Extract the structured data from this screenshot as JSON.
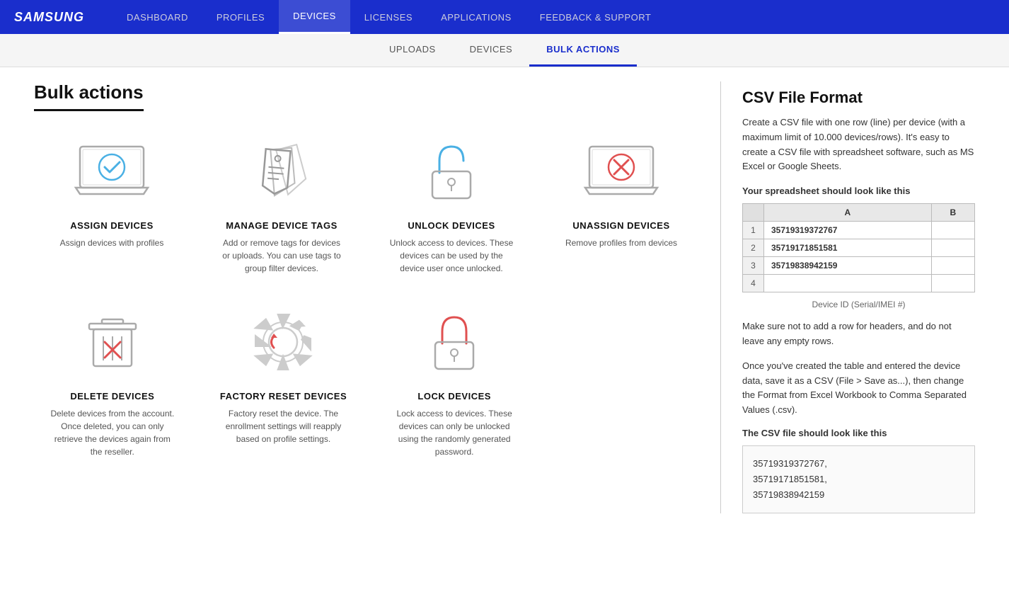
{
  "logo": "SAMSUNG",
  "nav": {
    "links": [
      {
        "label": "DASHBOARD",
        "active": false
      },
      {
        "label": "PROFILES",
        "active": false
      },
      {
        "label": "DEVICES",
        "active": true
      },
      {
        "label": "LICENSES",
        "active": false
      },
      {
        "label": "APPLICATIONS",
        "active": false
      },
      {
        "label": "FEEDBACK & SUPPORT",
        "active": false
      }
    ]
  },
  "subnav": {
    "tabs": [
      {
        "label": "UPLOADS",
        "active": false
      },
      {
        "label": "DEVICES",
        "active": false
      },
      {
        "label": "BULK ACTIONS",
        "active": true
      }
    ]
  },
  "page": {
    "title": "Bulk actions"
  },
  "actions_row1": [
    {
      "id": "assign",
      "title": "ASSIGN DEVICES",
      "desc": "Assign devices with profiles",
      "icon_type": "assign"
    },
    {
      "id": "manage-tags",
      "title": "MANAGE DEVICE TAGS",
      "desc": "Add or remove tags for devices or uploads. You can use tags to group filter devices.",
      "icon_type": "tags"
    },
    {
      "id": "unlock",
      "title": "UNLOCK DEVICES",
      "desc": "Unlock access to devices. These devices can be used by the device user once unlocked.",
      "icon_type": "unlock"
    },
    {
      "id": "unassign",
      "title": "UNASSIGN DEVICES",
      "desc": "Remove profiles from devices",
      "icon_type": "unassign"
    }
  ],
  "actions_row2": [
    {
      "id": "delete",
      "title": "DELETE DEVICES",
      "desc": "Delete devices from the account. Once deleted, you can only retrieve the devices again from the reseller.",
      "icon_type": "delete"
    },
    {
      "id": "factory-reset",
      "title": "FACTORY RESET DEVICES",
      "desc": "Factory reset the device. The enrollment settings will reapply based on profile settings.",
      "icon_type": "factory-reset"
    },
    {
      "id": "lock",
      "title": "LOCK DEVICES",
      "desc": "Lock access to devices. These devices can only be unlocked using the randomly generated password.",
      "icon_type": "lock"
    }
  ],
  "csv_panel": {
    "title": "CSV File Format",
    "desc": "Create a CSV file with one row (line) per device (with a maximum limit of 10.000 devices/rows). It's easy to create a CSV file with spreadsheet software, such as MS Excel or Google Sheets.",
    "spreadsheet_label": "Your spreadsheet should look like this",
    "columns": [
      "",
      "A",
      "B"
    ],
    "rows": [
      {
        "row": "1",
        "a": "35719319372767",
        "b": ""
      },
      {
        "row": "2",
        "a": "35719171851581",
        "b": ""
      },
      {
        "row": "3",
        "a": "35719838942159",
        "b": ""
      },
      {
        "row": "4",
        "a": "",
        "b": ""
      }
    ],
    "device_id_label": "Device ID (Serial/IMEI #)",
    "note1": "Make sure not to add a row for headers, and do not leave any empty rows.",
    "note2": "Once you've created the table and entered the device data, save it as a CSV (File > Save as...), then change the Format from Excel Workbook to Comma Separated Values (.csv).",
    "csv_file_label": "The CSV file should look like this",
    "csv_example": "35719319372767,\n35719171851581,\n35719838942159"
  }
}
